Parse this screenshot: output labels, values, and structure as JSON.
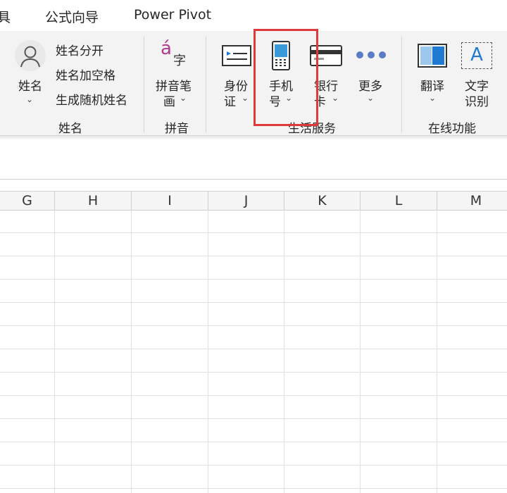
{
  "tabs": [
    {
      "label": "具"
    },
    {
      "label": "公式向导"
    },
    {
      "label": "Power Pivot"
    }
  ],
  "name_group": {
    "name_button": "姓名",
    "split_name": "姓名分开",
    "name_add_space": "姓名加空格",
    "random_name": "生成随机姓名",
    "group_label": "姓名"
  },
  "pinyin_group": {
    "button_line1": "拼音笔",
    "button_line2": "画",
    "icon_glyph_a": "á",
    "icon_glyph_zi": "字",
    "group_label": "拼音"
  },
  "life_group": {
    "id_line1": "身份",
    "id_line2": "证",
    "phone_line1": "手机",
    "phone_line2": "号",
    "bank_line1": "银行",
    "bank_line2": "卡",
    "more": "更多",
    "group_label": "生活服务"
  },
  "online_group": {
    "translate": "翻译",
    "ocr_line1": "文字",
    "ocr_line2": "识别",
    "ocr_icon_letter": "A",
    "group_label": "在线功能"
  },
  "columns": [
    "G",
    "H",
    "I",
    "J",
    "K",
    "L",
    "M"
  ],
  "colors": {
    "highlight": "#e0393a",
    "pinyin_accent": "#b03a8f",
    "phone_blue": "#3a9ad9",
    "translate_blue": "#1f7bd1"
  },
  "icons": [
    "user-icon",
    "pinyin-icon",
    "id-card-icon",
    "phone-icon",
    "bank-card-icon",
    "more-dots-icon",
    "translate-icon",
    "ocr-icon"
  ]
}
